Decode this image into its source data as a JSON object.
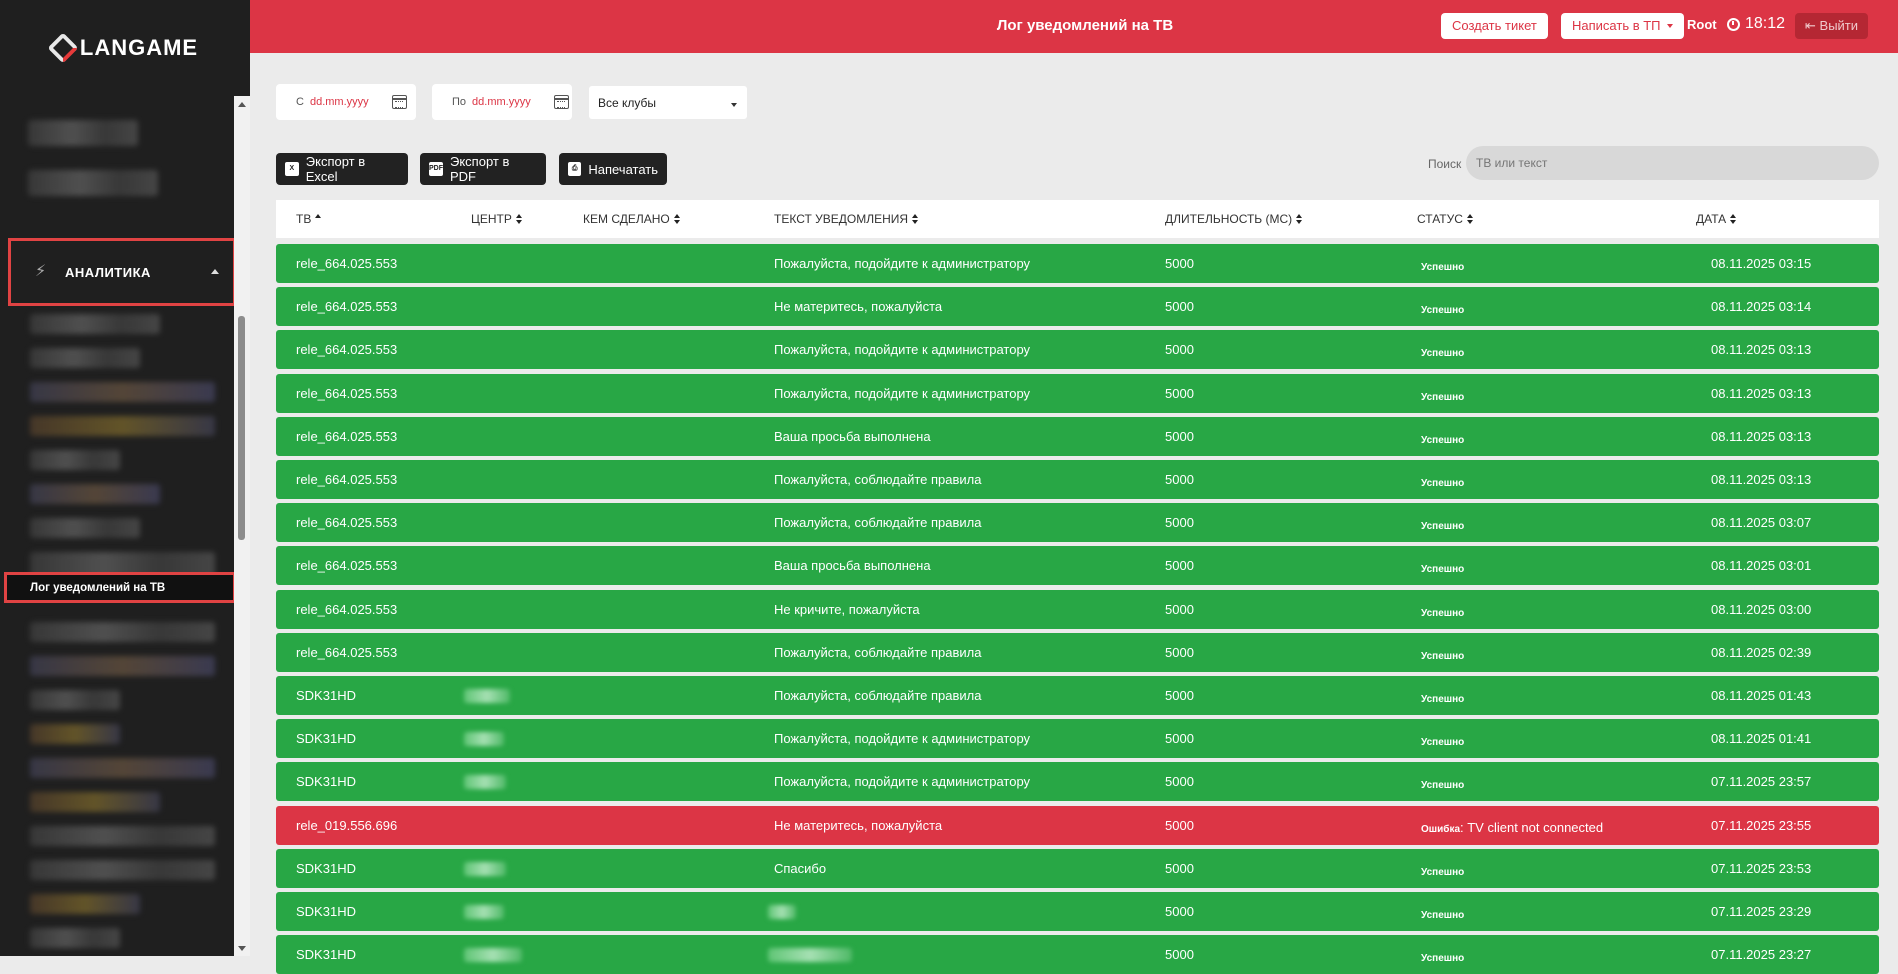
{
  "app": {
    "logo_text": "LANGAME"
  },
  "header": {
    "title": "Лог уведомлений на ТВ",
    "create_ticket": "Создать тикет",
    "write_support": "Написать в ТП",
    "user": "Root",
    "time": "18:12",
    "logout": "Выйти"
  },
  "sidebar": {
    "section_label": "АНАЛИТИКА",
    "active_item": "Лог уведомлений на ТВ"
  },
  "filters": {
    "from_label": "С",
    "from_placeholder": "dd.mm.yyyy",
    "to_label": "По",
    "to_placeholder": "dd.mm.yyyy",
    "club_select": "Все клубы"
  },
  "actions": {
    "export_excel": "Экспорт в Excel",
    "export_pdf": "Экспорт в PDF",
    "print": "Напечатать",
    "search_label": "Поиск",
    "search_placeholder": "ТВ или текст"
  },
  "table": {
    "columns": [
      "ТВ",
      "ЦЕНТР",
      "КЕМ СДЕЛАНО",
      "ТЕКСТ УВЕДОМЛЕНИЯ",
      "ДЛИТЕЛЬНОСТЬ (МС)",
      "СТАТУС",
      "ДАТА"
    ],
    "rows": [
      {
        "tv": "rele_664.025.553",
        "text": "Пожалуйста, подойдите к администратору",
        "duration": "5000",
        "status": "Успешно",
        "status_extra": "",
        "date": "08.11.2025 03:15",
        "ok": true
      },
      {
        "tv": "rele_664.025.553",
        "text": "Не материтесь, пожалуйста",
        "duration": "5000",
        "status": "Успешно",
        "status_extra": "",
        "date": "08.11.2025 03:14",
        "ok": true
      },
      {
        "tv": "rele_664.025.553",
        "text": "Пожалуйста, подойдите к администратору",
        "duration": "5000",
        "status": "Успешно",
        "status_extra": "",
        "date": "08.11.2025 03:13",
        "ok": true
      },
      {
        "tv": "rele_664.025.553",
        "text": "Пожалуйста, подойдите к администратору",
        "duration": "5000",
        "status": "Успешно",
        "status_extra": "",
        "date": "08.11.2025 03:13",
        "ok": true
      },
      {
        "tv": "rele_664.025.553",
        "text": "Ваша просьба выполнена",
        "duration": "5000",
        "status": "Успешно",
        "status_extra": "",
        "date": "08.11.2025 03:13",
        "ok": true
      },
      {
        "tv": "rele_664.025.553",
        "text": "Пожалуйста, соблюдайте правила",
        "duration": "5000",
        "status": "Успешно",
        "status_extra": "",
        "date": "08.11.2025 03:13",
        "ok": true
      },
      {
        "tv": "rele_664.025.553",
        "text": "Пожалуйста, соблюдайте правила",
        "duration": "5000",
        "status": "Успешно",
        "status_extra": "",
        "date": "08.11.2025 03:07",
        "ok": true
      },
      {
        "tv": "rele_664.025.553",
        "text": "Ваша просьба выполнена",
        "duration": "5000",
        "status": "Успешно",
        "status_extra": "",
        "date": "08.11.2025 03:01",
        "ok": true
      },
      {
        "tv": "rele_664.025.553",
        "text": "Не кричите, пожалуйста",
        "duration": "5000",
        "status": "Успешно",
        "status_extra": "",
        "date": "08.11.2025 03:00",
        "ok": true
      },
      {
        "tv": "rele_664.025.553",
        "text": "Пожалуйста, соблюдайте правила",
        "duration": "5000",
        "status": "Успешно",
        "status_extra": "",
        "date": "08.11.2025 02:39",
        "ok": true
      },
      {
        "tv": "SDK31HD",
        "text": "Пожалуйста, соблюдайте правила",
        "duration": "5000",
        "status": "Успешно",
        "status_extra": "",
        "date": "08.11.2025 01:43",
        "ok": true
      },
      {
        "tv": "SDK31HD",
        "text": "Пожалуйста, подойдите к администратору",
        "duration": "5000",
        "status": "Успешно",
        "status_extra": "",
        "date": "08.11.2025 01:41",
        "ok": true
      },
      {
        "tv": "SDK31HD",
        "text": "Пожалуйста, подойдите к администратору",
        "duration": "5000",
        "status": "Успешно",
        "status_extra": "",
        "date": "07.11.2025 23:57",
        "ok": true
      },
      {
        "tv": "rele_019.556.696",
        "text": "Не материтесь, пожалуйста",
        "duration": "5000",
        "status": "Ошибка",
        "status_extra": ": TV client not connected",
        "date": "07.11.2025 23:55",
        "ok": false
      },
      {
        "tv": "SDK31HD",
        "text": "Спасибо",
        "duration": "5000",
        "status": "Успешно",
        "status_extra": "",
        "date": "07.11.2025 23:53",
        "ok": true
      },
      {
        "tv": "SDK31HD",
        "text": "",
        "duration": "5000",
        "status": "Успешно",
        "status_extra": "",
        "date": "07.11.2025 23:29",
        "ok": true
      },
      {
        "tv": "SDK31HD",
        "text": "",
        "duration": "5000",
        "status": "Успешно",
        "status_extra": "",
        "date": "07.11.2025 23:27",
        "ok": true
      }
    ]
  },
  "colors": {
    "header": "#dc3545",
    "success_row": "#28a745",
    "error_row": "#dc3545",
    "sidebar": "#1f1f1f"
  }
}
